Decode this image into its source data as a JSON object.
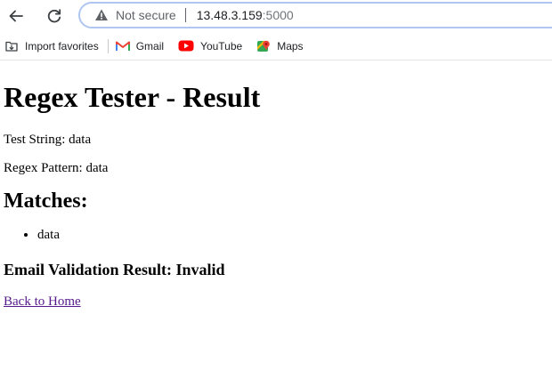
{
  "browser": {
    "security_label": "Not secure",
    "url_host": "13.48.3.159",
    "url_port": ":5000",
    "icons": {
      "back": "arrow-left-icon",
      "reload": "reload-icon",
      "security": "warning-triangle-icon"
    }
  },
  "bookmarks": [
    {
      "label": "Import favorites",
      "icon": "import-favorites-icon"
    },
    {
      "label": "Gmail",
      "icon": "gmail-icon",
      "color": "#ea4335"
    },
    {
      "label": "YouTube",
      "icon": "youtube-icon",
      "color": "#ff0000"
    },
    {
      "label": "Maps",
      "icon": "maps-icon",
      "color": "#34a853"
    }
  ],
  "page": {
    "title": "Regex Tester - Result",
    "test_string": "Test String: data",
    "regex_pattern": "Regex Pattern: data",
    "matches_heading": "Matches:",
    "matches": [
      "data"
    ],
    "email_result": "Email Validation Result: Invalid",
    "back_link": "Back to Home",
    "link_color": "#551a8b"
  }
}
